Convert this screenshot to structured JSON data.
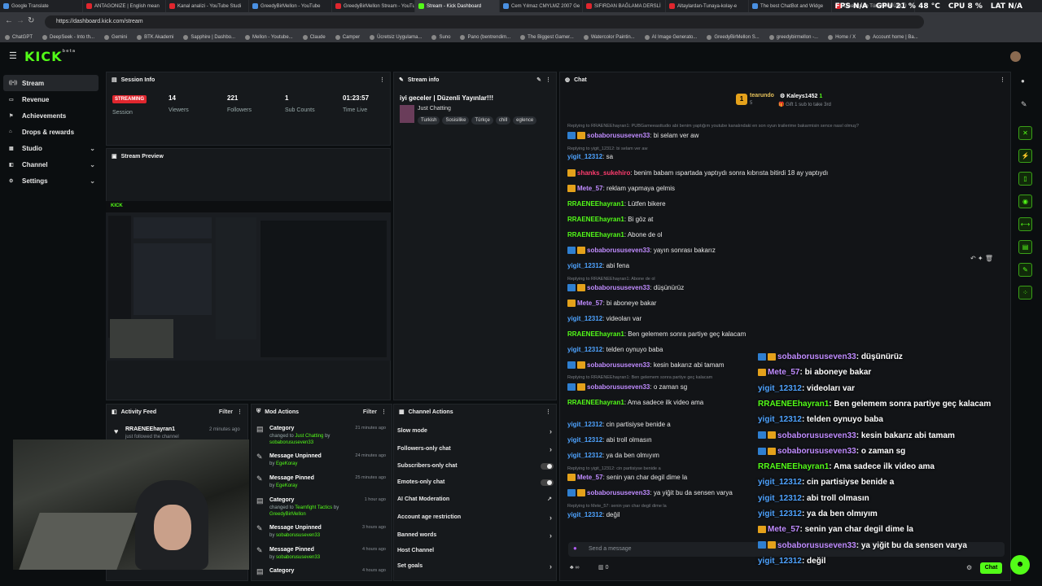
{
  "browser": {
    "tabs": [
      "Google Translate",
      "ANTAGONIZE | English mean",
      "Kanal analizi - YouTube Studi",
      "GreedyBirMellon - YouTube",
      "GreedyBirMellon Stream - YouTube",
      "Stream - Kick Dashboard",
      "Cem Yılmaz CMYLMZ 2007 Ge",
      "SIFIRDAN BAĞLAMA DERSLİ",
      "Altaylardan-Tunaya-kolay-e",
      "The best ChatBot and Widge",
      "Orkestra ile Türk Rock ÜNLÜ"
    ],
    "url": "https://dashboard.kick.com/stream",
    "bookmarks": [
      "ChatGPT",
      "DeepSeek - Into th...",
      "Gemini",
      "BTK Akademi",
      "Sapphire | Dashbo...",
      "Mellon - Youtube...",
      "Claude",
      "Camper",
      "Ücretsiz Uygulama...",
      "Suno",
      "Pano (bentrendim...",
      "The Biggest Gamer...",
      "Watercolor Paintin...",
      "AI Image Generato...",
      "GreedyBirMellon S...",
      "greedybirmellon -...",
      "Home / X",
      "Account home | Ba..."
    ]
  },
  "hud": {
    "fps_label": "FPS",
    "fps": "N/A",
    "gpu_label": "GPU",
    "gpu": "21 % 48 °C",
    "cpu_label": "CPU",
    "cpu": "8 %",
    "lat_label": "LAT",
    "lat": "N/A"
  },
  "brand": {
    "logo": "KICK",
    "beta": "beta"
  },
  "sidebar": [
    {
      "label": "Stream"
    },
    {
      "label": "Revenue"
    },
    {
      "label": "Achievements"
    },
    {
      "label": "Drops & rewards"
    },
    {
      "label": "Studio"
    },
    {
      "label": "Channel"
    },
    {
      "label": "Settings"
    }
  ],
  "session": {
    "title": "Session Info",
    "status": "STREAMING",
    "status_label": "Session",
    "viewers": "14",
    "viewers_label": "Viewers",
    "followers": "221",
    "followers_label": "Followers",
    "subs": "1",
    "subs_label": "Sub Counts",
    "time": "01:23:57",
    "time_label": "Time Live"
  },
  "stream_info": {
    "title": "Stream info",
    "stream_title": "iyi geceler | Düzenli Yayınlar!!!",
    "category": "Just Chatting",
    "tags": [
      "Turkish",
      "Sosisilike",
      "Türkçe",
      "chill",
      "eglence"
    ]
  },
  "preview": {
    "title": "Stream Preview"
  },
  "chat": {
    "title": "Chat",
    "top_gifter": "tearundo",
    "top_gifter_count": "5",
    "gifter2": "Kaleys1452",
    "gifter2_count": "1",
    "gift_note": "Gift 1 sub to take 3rd",
    "placeholder": "Send a message",
    "send": "Chat",
    "viewers_count": "0",
    "reply1": "Replying to RRAENEEhayran1: PUBGameeasttudio abi benim yaptığım youtube kanalındaki en son oyun trailerime bakarmisin sence nasıl olmuş?",
    "reply2": "Replying to yigit_12312: bi selam ver aw",
    "reply3": "Replying to RRAENEEhayran1: Abone de ol",
    "reply4": "Replying to RRAENEEhayran1: Ben gelemem sonra partiye geç kalacam",
    "reply5": "Replying to yigit_12312: cin partisiyse benide a",
    "reply6": "Replying to Mete_57: senin yan char degil dime la",
    "lines": [
      {
        "user": "sobaborususeven33",
        "msg": "bi selam ver aw"
      },
      {
        "user": "yigit_12312",
        "msg": "sa"
      },
      {
        "user": "shanks_sukehiro",
        "msg": "benim babam ıspartada yaptıydı sonra kıbrısta bitirdi 18 ay yaptıydı"
      },
      {
        "user": "Mete_57",
        "msg": "reklam yapmaya gelmis"
      },
      {
        "user": "RRAENEEhayran1",
        "msg": "Lütfen bikere"
      },
      {
        "user": "RRAENEEhayran1",
        "msg": "Bi göz at"
      },
      {
        "user": "RRAENEEhayran1",
        "msg": "Abone de ol"
      },
      {
        "user": "sobaborususeven33",
        "msg": "yayın sonrası bakarız"
      },
      {
        "user": "yigit_12312",
        "msg": "abi fena"
      },
      {
        "user": "sobaborususeven33",
        "msg": "düşünürüz"
      },
      {
        "user": "Mete_57",
        "msg": "bi aboneye bakar"
      },
      {
        "user": "yigit_12312",
        "msg": "videoları var"
      },
      {
        "user": "RRAENEEhayran1",
        "msg": "Ben gelemem sonra partiye geç kalacam"
      },
      {
        "user": "yigit_12312",
        "msg": "telden oynuyo baba"
      },
      {
        "user": "sobaborususeven33",
        "msg": "kesin bakarız abi tamam"
      },
      {
        "user": "sobaborususeven33",
        "msg": "o zaman sg"
      },
      {
        "user": "RRAENEEhayran1",
        "msg": "Ama sadece ilk video ama"
      },
      {
        "user": "yigit_12312",
        "msg": "cin partisiyse benide a"
      },
      {
        "user": "yigit_12312",
        "msg": "abi troll olmasın"
      },
      {
        "user": "yigit_12312",
        "msg": "ya da ben olmıyım"
      },
      {
        "user": "Mete_57",
        "msg": "senin yan char degil dime la"
      },
      {
        "user": "sobaborususeven33",
        "msg": "ya yiğit bu da sensen varya"
      },
      {
        "user": "yigit_12312",
        "msg": "değil"
      }
    ]
  },
  "overlay": [
    {
      "user": "sobaborususeven33",
      "msg": ": düşünürüz"
    },
    {
      "user": "Mete_57",
      "msg": ": bi aboneye bakar"
    },
    {
      "user": "yigit_12312",
      "msg": ": videoları var"
    },
    {
      "user": "RRAENEEhayran1",
      "msg": ": Ben gelemem sonra partiye geç kalacam"
    },
    {
      "user": "yigit_12312",
      "msg": ": telden oynuyo baba"
    },
    {
      "user": "sobaborususeven33",
      "msg": ": kesin bakarız abi tamam"
    },
    {
      "user": "sobaborususeven33",
      "msg": ": o zaman sg"
    },
    {
      "user": "RRAENEEhayran1",
      "msg": ": Ama sadece ilk video ama"
    },
    {
      "user": "yigit_12312",
      "msg": ": cin partisiyse benide a"
    },
    {
      "user": "yigit_12312",
      "msg": ": abi troll olmasın"
    },
    {
      "user": "yigit_12312",
      "msg": ": ya da ben olmıyım"
    },
    {
      "user": "Mete_57",
      "msg": ": senin yan char degil dime la"
    },
    {
      "user": "sobaborususeven33",
      "msg": ": ya yiğit bu da sensen varya"
    },
    {
      "user": "yigit_12312",
      "msg": ": değil"
    }
  ],
  "activity": {
    "title": "Activity Feed",
    "filter": "Filter",
    "user": "RRAENEEhayran1",
    "time": "2 minutes ago",
    "action": "just followed the channel"
  },
  "mod_actions": {
    "title": "Mod Actions",
    "filter": "Filter",
    "items": [
      {
        "title": "Category",
        "detail": "changed to",
        "target": "Just Chatting",
        "by": "by",
        "who": "sobaborususeven33",
        "time": "21 minutes ago"
      },
      {
        "title": "Message Unpinned",
        "detail": "",
        "target": "",
        "by": "by",
        "who": "EgeKoray",
        "time": "24 minutes ago"
      },
      {
        "title": "Message Pinned",
        "detail": "",
        "target": "",
        "by": "by",
        "who": "EgeKoray",
        "time": "25 minutes ago"
      },
      {
        "title": "Category",
        "detail": "changed to",
        "target": "Teamfight Tactics",
        "by": "by",
        "who": "GreedyBirMellon",
        "time": "1 hour ago"
      },
      {
        "title": "Message Unpinned",
        "detail": "",
        "target": "",
        "by": "by",
        "who": "sobaborususeven33",
        "time": "3 hours ago"
      },
      {
        "title": "Message Pinned",
        "detail": "",
        "target": "",
        "by": "by",
        "who": "sobaborususeven33",
        "time": "4 hours ago"
      },
      {
        "title": "Category",
        "detail": "",
        "target": "",
        "by": "",
        "who": "",
        "time": "4 hours ago"
      }
    ]
  },
  "channel_actions": {
    "title": "Channel Actions",
    "items": [
      "Slow mode",
      "Followers-only chat",
      "Subscribers-only chat",
      "Emotes-only chat",
      "AI Chat Moderation",
      "Account age restriction",
      "Banned words",
      "Host Channel",
      "Set goals"
    ]
  },
  "colors": {
    "brand": "#53fc18",
    "live": "#e0262e",
    "panel": "#16191c"
  }
}
